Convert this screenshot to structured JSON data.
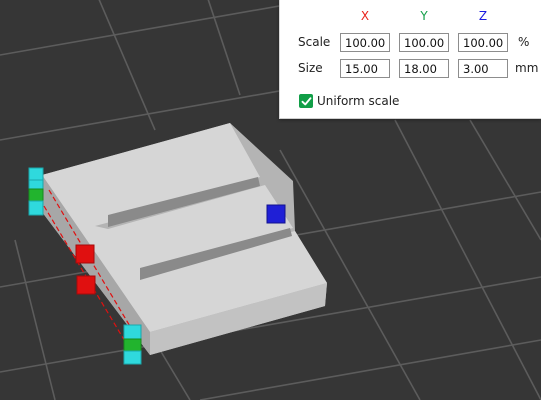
{
  "scale_panel": {
    "axes": [
      {
        "label": "X",
        "color": "#e8231c"
      },
      {
        "label": "Y",
        "color": "#119e47"
      },
      {
        "label": "Z",
        "color": "#1c1ce0"
      }
    ],
    "scale": {
      "label": "Scale",
      "x": "100.00",
      "y": "100.00",
      "z": "100.00",
      "unit": "%"
    },
    "size": {
      "label": "Size",
      "x": "15.00",
      "y": "18.00",
      "z": "3.00",
      "unit": "mm"
    },
    "uniform_scale": {
      "label": "Uniform scale",
      "checked": true,
      "color": "#119e47"
    }
  },
  "scene": {
    "background_color": "#363636",
    "grid_color": "#5c5c5c",
    "model_top_color": "#d6d6d6",
    "model_side_color": "#b4b4b4",
    "handle_colors": {
      "cyan": "#2fd9dd",
      "green": "#22b42e",
      "red": "#e01010",
      "blue": "#1f1fd6"
    }
  }
}
